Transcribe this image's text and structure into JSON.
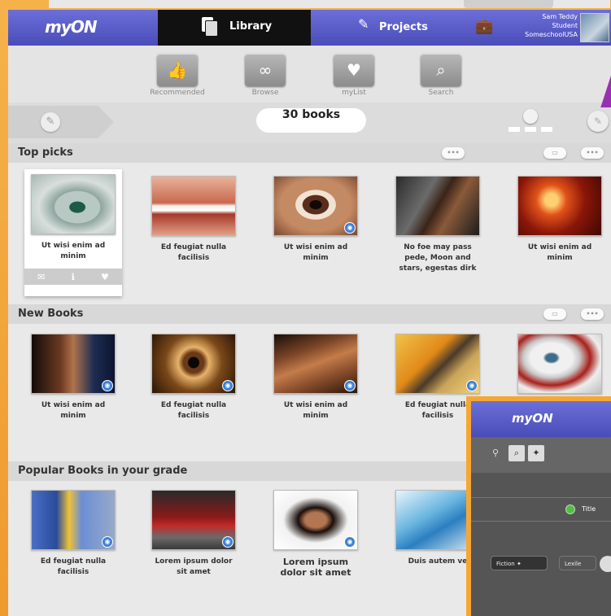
{
  "nav": {
    "logo": "myON",
    "tabs": [
      {
        "label": "Library",
        "active": true
      },
      {
        "label": "Projects",
        "active": false
      }
    ],
    "user": {
      "name": "Sam Teddy",
      "role": "Student",
      "school": "SomeschoolUSA"
    }
  },
  "subnav": [
    {
      "label": "Recommended",
      "icon": "thumbs-up-icon"
    },
    {
      "label": "Browse",
      "icon": "binoculars-icon"
    },
    {
      "label": "myList",
      "icon": "heart-icon"
    },
    {
      "label": "Search",
      "icon": "search-icon"
    }
  ],
  "filter": {
    "count": "30 books"
  },
  "sections": [
    {
      "title": "Top picks",
      "books": [
        {
          "caption": "Ut wisi enim ad minim",
          "selected": true
        },
        {
          "caption": "Ed feugiat nulla facilisis"
        },
        {
          "caption": "Ut wisi enim ad minim"
        },
        {
          "caption": "No foe may pass pede, Moon and stars, egestas dirk"
        },
        {
          "caption": "Ut wisi enim ad minim"
        }
      ]
    },
    {
      "title": "New Books",
      "books": [
        {
          "caption": "Ut wisi enim ad minim"
        },
        {
          "caption": "Ed feugiat nulla facilisis"
        },
        {
          "caption": "Ut wisi enim ad minim"
        },
        {
          "caption": "Ed feugiat nulla facilisis"
        },
        {
          "caption": ""
        }
      ]
    },
    {
      "title": "Popular Books in your grade",
      "books": [
        {
          "caption": "Ed feugiat nulla facilisis"
        },
        {
          "caption": "Lorem ipsum dolor sit amet"
        },
        {
          "caption": "Lorem ipsum dolor sit amet"
        },
        {
          "caption": "Duis autem ve"
        }
      ]
    }
  ],
  "overlay": {
    "logo": "myON",
    "title_label": "Title",
    "chips": [
      "Fiction",
      "Lexile"
    ]
  }
}
